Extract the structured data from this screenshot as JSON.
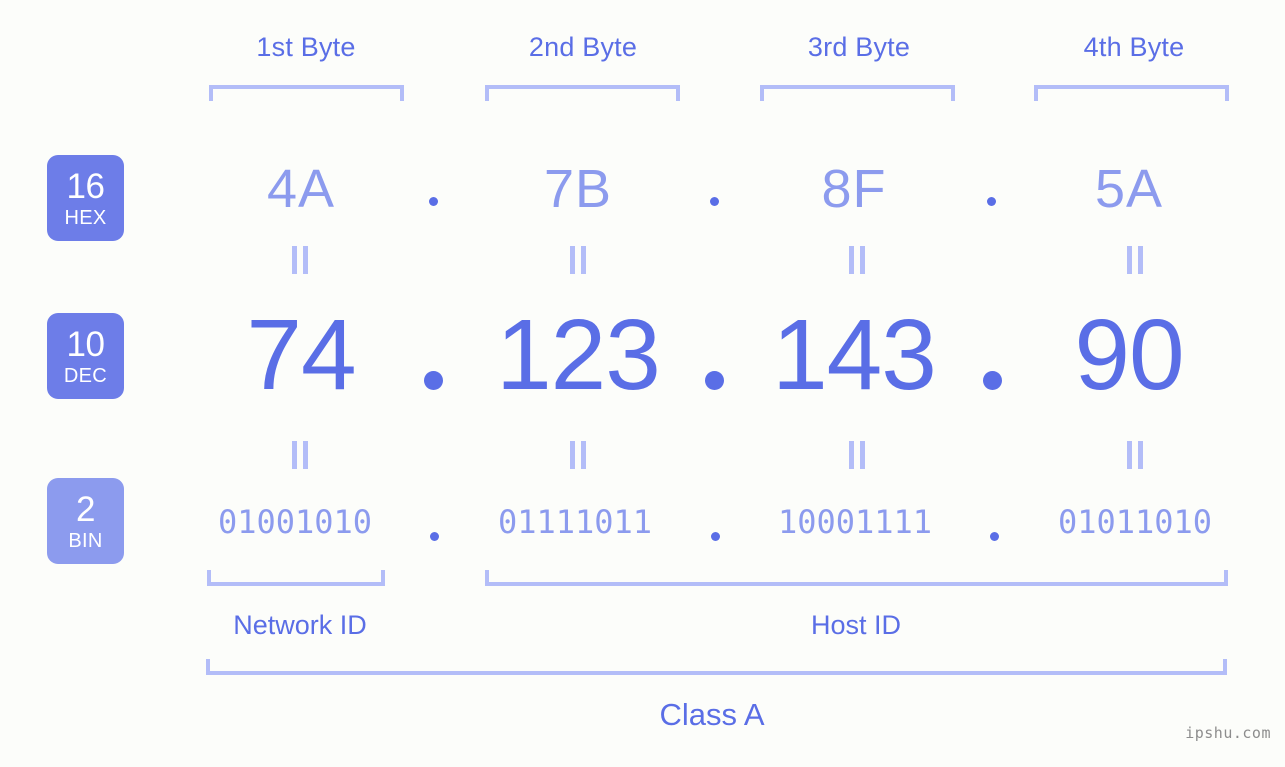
{
  "meta": {
    "background_color": "#fcfdfa",
    "accent_color": "#5a6ee6",
    "accent_light_color": "#8c9bee",
    "bracket_color": "#b3bdf8",
    "badge_color": "#6d7de8",
    "badge_light_color": "#8c9bee"
  },
  "byte_headers": [
    {
      "label": "1st Byte"
    },
    {
      "label": "2nd Byte"
    },
    {
      "label": "3rd Byte"
    },
    {
      "label": "4th Byte"
    }
  ],
  "bases": [
    {
      "number": "16",
      "name": "HEX"
    },
    {
      "number": "10",
      "name": "DEC"
    },
    {
      "number": "2",
      "name": "BIN"
    }
  ],
  "rows": {
    "hex": {
      "values": [
        "4A",
        "7B",
        "8F",
        "5A"
      ],
      "separator": "."
    },
    "dec": {
      "values": [
        "74",
        "123",
        "143",
        "90"
      ],
      "separator": "."
    },
    "bin": {
      "values": [
        "01001010",
        "01111011",
        "10001111",
        "01011010"
      ],
      "separator": "."
    }
  },
  "equality_symbol": "=",
  "sections": [
    {
      "label": "Network ID"
    },
    {
      "label": "Host ID"
    }
  ],
  "class": {
    "label": "Class A"
  },
  "watermark": {
    "text": "ipshu.com"
  }
}
